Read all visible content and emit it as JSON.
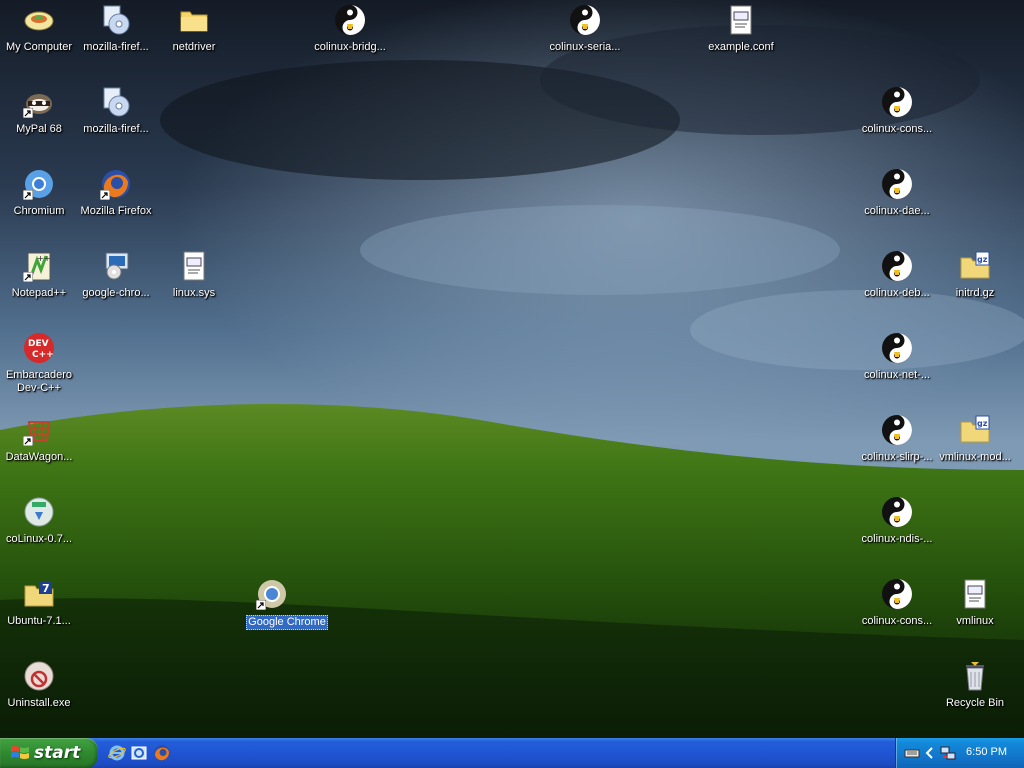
{
  "desktop": {
    "icons": [
      {
        "label": "My Computer"
      },
      {
        "label": "mozilla-firef..."
      },
      {
        "label": "netdriver"
      },
      {
        "label": "colinux-bridg..."
      },
      {
        "label": "colinux-seria..."
      },
      {
        "label": "example.conf"
      },
      {
        "label": "MyPal 68"
      },
      {
        "label": "mozilla-firef..."
      },
      {
        "label": "colinux-cons..."
      },
      {
        "label": "Chromium"
      },
      {
        "label": "Mozilla Firefox"
      },
      {
        "label": "colinux-dae..."
      },
      {
        "label": "Notepad++"
      },
      {
        "label": "google-chro..."
      },
      {
        "label": "linux.sys"
      },
      {
        "label": "colinux-deb..."
      },
      {
        "label": "initrd.gz"
      },
      {
        "label": "Embarcadero Dev-C++"
      },
      {
        "label": "colinux-net-..."
      },
      {
        "label": "DataWagon..."
      },
      {
        "label": "colinux-slirp-..."
      },
      {
        "label": "vmlinux-mod..."
      },
      {
        "label": "coLinux-0.7..."
      },
      {
        "label": "colinux-ndis-..."
      },
      {
        "label": "Ubuntu-7.1..."
      },
      {
        "label": "Google Chrome"
      },
      {
        "label": "colinux-cons..."
      },
      {
        "label": "vmlinux"
      },
      {
        "label": "Uninstall.exe"
      },
      {
        "label": "Recycle Bin"
      }
    ]
  },
  "taskbar": {
    "start_label": "start",
    "clock": "6:50 PM"
  },
  "colors": {
    "taskbar_blue": "#245edb",
    "start_green": "#3c9c3c",
    "tray_blue": "#138ad9",
    "selection_blue": "#316ac5"
  }
}
